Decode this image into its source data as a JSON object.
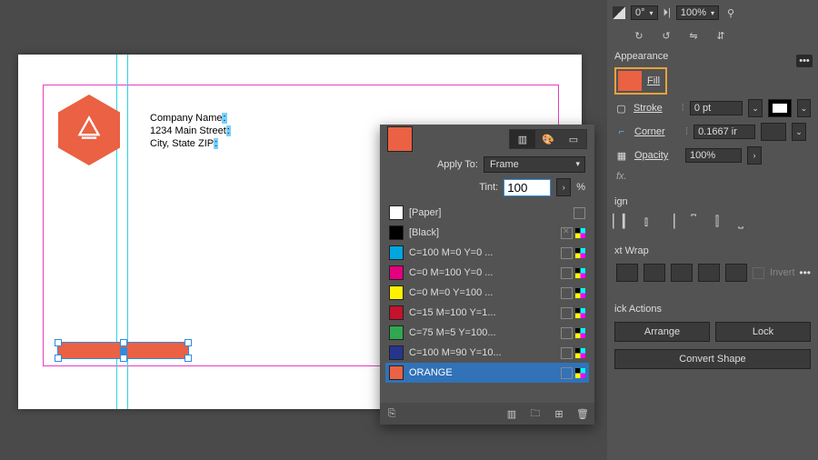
{
  "canvas": {
    "company_name_label": "Company Name",
    "address_line1": "1234 Main Street",
    "address_line2": "City, State ZIP"
  },
  "swatch_panel": {
    "apply_to_label": "Apply To:",
    "apply_to_value": "Frame",
    "tint_label": "Tint:",
    "tint_value": "100",
    "tint_unit": "%",
    "items": [
      {
        "name": "[Paper]",
        "color": "#ffffff",
        "pencil_x": false,
        "cmyk": false
      },
      {
        "name": "[Black]",
        "color": "#000000",
        "pencil_x": true,
        "cmyk": true
      },
      {
        "name": "C=100 M=0 Y=0 ...",
        "color": "#00a6e0",
        "pencil_x": false,
        "cmyk": true
      },
      {
        "name": "C=0 M=100 Y=0 ...",
        "color": "#e4007f",
        "pencil_x": false,
        "cmyk": true
      },
      {
        "name": "C=0 M=0 Y=100 ...",
        "color": "#fff200",
        "pencil_x": false,
        "cmyk": true
      },
      {
        "name": "C=15 M=100 Y=1...",
        "color": "#c4132a",
        "pencil_x": false,
        "cmyk": true
      },
      {
        "name": "C=75 M=5 Y=100...",
        "color": "#2fa84f",
        "pencil_x": false,
        "cmyk": true
      },
      {
        "name": "C=100 M=90 Y=10...",
        "color": "#26358c",
        "pencil_x": false,
        "cmyk": true
      },
      {
        "name": "ORANGE",
        "color": "#ea6143",
        "pencil_x": false,
        "cmyk": true,
        "selected": true
      }
    ]
  },
  "top_bar": {
    "angle": "0°",
    "opacity": "100%"
  },
  "appearance": {
    "title": "Appearance",
    "fill_label": "Fill",
    "stroke_label": "Stroke",
    "stroke_value": "0 pt",
    "corner_label": "Corner",
    "corner_value": "0.1667 ir",
    "opacity_label": "Opacity",
    "opacity_value": "100%",
    "fx_label": "fx."
  },
  "align": {
    "title": "ign"
  },
  "text_wrap": {
    "title": "xt Wrap",
    "invert_label": "Invert"
  },
  "quick_actions": {
    "title": "ick Actions",
    "arrange": "Arrange",
    "lock": "Lock",
    "convert": "Convert Shape"
  },
  "chart_data": null
}
